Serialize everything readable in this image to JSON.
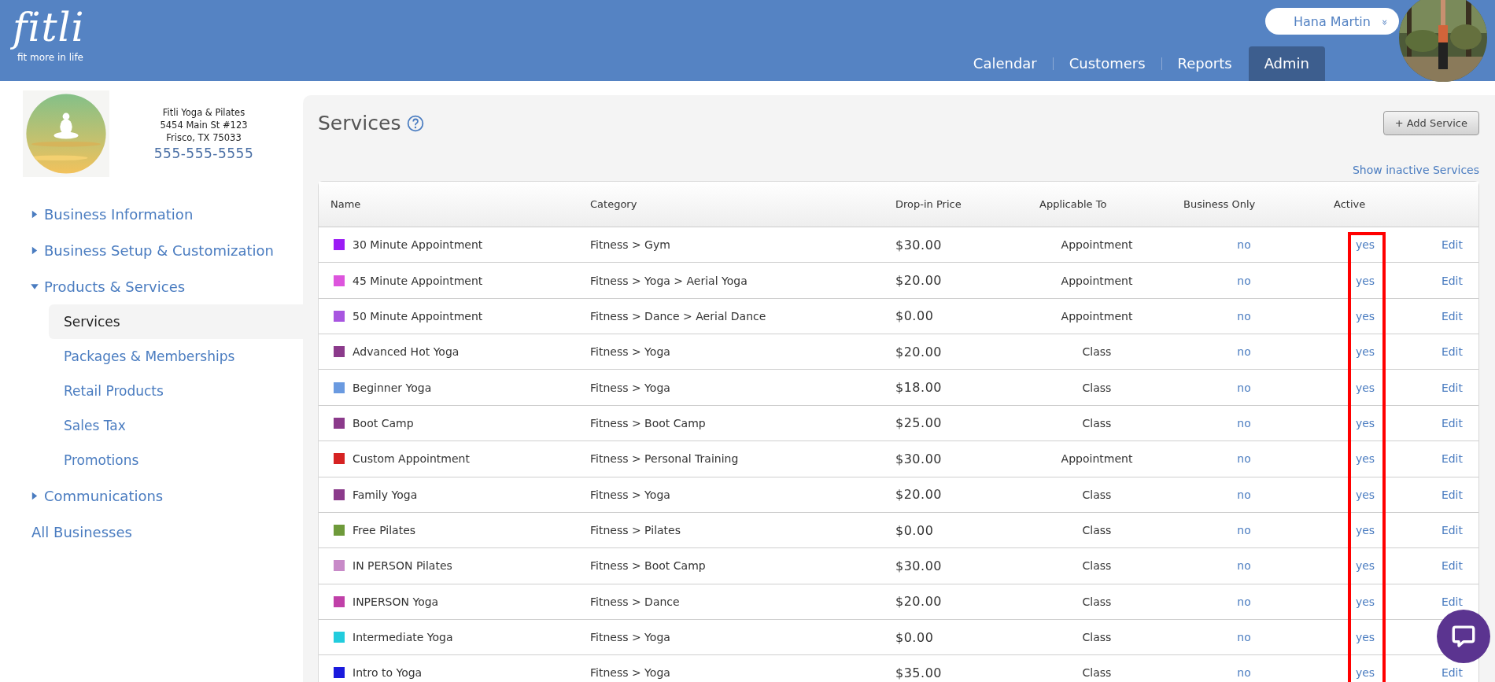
{
  "brand": {
    "logo": "fitli",
    "tagline": "fit more in life"
  },
  "user": {
    "name": "Hana Martin",
    "caret": "»"
  },
  "nav": [
    {
      "label": "Calendar",
      "selected": false
    },
    {
      "label": "Customers",
      "selected": false
    },
    {
      "label": "Reports",
      "selected": false
    },
    {
      "label": "Admin",
      "selected": true
    }
  ],
  "business": {
    "name": "Fitli Yoga & Pilates",
    "address": "5454 Main St #123",
    "city": "Frisco, TX 75033",
    "phone": "555-555-5555"
  },
  "sidebar": {
    "items": [
      {
        "label": "Business Information",
        "kind": "group",
        "expanded": false
      },
      {
        "label": "Business Setup & Customization",
        "kind": "group",
        "expanded": false
      },
      {
        "label": "Products & Services",
        "kind": "group",
        "expanded": true,
        "children": [
          {
            "label": "Services",
            "selected": true
          },
          {
            "label": "Packages & Memberships",
            "selected": false
          },
          {
            "label": "Retail Products",
            "selected": false
          },
          {
            "label": "Sales Tax",
            "selected": false
          },
          {
            "label": "Promotions",
            "selected": false
          }
        ]
      },
      {
        "label": "Communications",
        "kind": "group",
        "expanded": false
      },
      {
        "label": "All Businesses",
        "kind": "link"
      }
    ]
  },
  "page": {
    "title": "Services",
    "add_button": "+ Add Service",
    "inactive_link": "Show inactive Services"
  },
  "table": {
    "columns": [
      "Name",
      "Category",
      "Drop-in Price",
      "Applicable To",
      "Business Only",
      "Active"
    ],
    "rows": [
      {
        "name": "30 Minute Appointment",
        "color": "#9b1cf5",
        "category": "Fitness > Gym",
        "price": "$30.00",
        "applicable": "Appointment",
        "business_only": "no",
        "active": "yes",
        "edit": "Edit"
      },
      {
        "name": "45 Minute Appointment",
        "color": "#dd55dd",
        "category": "Fitness > Yoga > Aerial Yoga",
        "price": "$20.00",
        "applicable": "Appointment",
        "business_only": "no",
        "active": "yes",
        "edit": "Edit"
      },
      {
        "name": "50 Minute Appointment",
        "color": "#a855e0",
        "category": "Fitness > Dance > Aerial Dance",
        "price": "$0.00",
        "applicable": "Appointment",
        "business_only": "no",
        "active": "yes",
        "edit": "Edit"
      },
      {
        "name": "Advanced Hot Yoga",
        "color": "#8b3a8b",
        "category": "Fitness > Yoga",
        "price": "$20.00",
        "applicable": "Class",
        "business_only": "no",
        "active": "yes",
        "edit": "Edit"
      },
      {
        "name": "Beginner Yoga",
        "color": "#6a9ae0",
        "category": "Fitness > Yoga",
        "price": "$18.00",
        "applicable": "Class",
        "business_only": "no",
        "active": "yes",
        "edit": "Edit"
      },
      {
        "name": "Boot Camp",
        "color": "#8b3a8b",
        "category": "Fitness > Boot Camp",
        "price": "$25.00",
        "applicable": "Class",
        "business_only": "no",
        "active": "yes",
        "edit": "Edit"
      },
      {
        "name": "Custom Appointment",
        "color": "#d62222",
        "category": "Fitness > Personal Training",
        "price": "$30.00",
        "applicable": "Appointment",
        "business_only": "no",
        "active": "yes",
        "edit": "Edit"
      },
      {
        "name": "Family Yoga",
        "color": "#8b3a8b",
        "category": "Fitness > Yoga",
        "price": "$20.00",
        "applicable": "Class",
        "business_only": "no",
        "active": "yes",
        "edit": "Edit"
      },
      {
        "name": "Free Pilates",
        "color": "#6e9a3a",
        "category": "Fitness > Pilates",
        "price": "$0.00",
        "applicable": "Class",
        "business_only": "no",
        "active": "yes",
        "edit": "Edit"
      },
      {
        "name": "IN PERSON Pilates",
        "color": "#c88ac8",
        "category": "Fitness > Boot Camp",
        "price": "$30.00",
        "applicable": "Class",
        "business_only": "no",
        "active": "yes",
        "edit": "Edit"
      },
      {
        "name": "INPERSON Yoga",
        "color": "#c040a8",
        "category": "Fitness > Dance",
        "price": "$20.00",
        "applicable": "Class",
        "business_only": "no",
        "active": "yes",
        "edit": "Edit"
      },
      {
        "name": "Intermediate Yoga",
        "color": "#22ccdd",
        "category": "Fitness > Yoga",
        "price": "$0.00",
        "applicable": "Class",
        "business_only": "no",
        "active": "yes"
      },
      {
        "name": "Intro to Yoga",
        "color": "#1a1add",
        "category": "Fitness > Yoga",
        "price": "$35.00",
        "applicable": "Class",
        "business_only": "no",
        "active": "yes",
        "edit": "Edit"
      }
    ]
  }
}
